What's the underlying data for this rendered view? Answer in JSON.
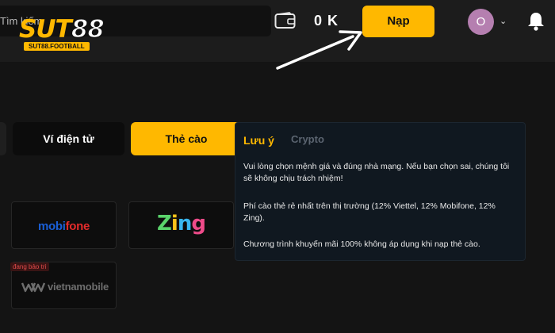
{
  "header": {
    "search_placeholder": "Tìm kiếm",
    "logo": {
      "brand": "SUT88",
      "brand_prefix": "SUT",
      "brand_suffix": "88",
      "sub": "SUT88.FOOTBALL"
    },
    "balance": "0 K",
    "deposit_label": "Nạp",
    "avatar_initial": "O",
    "icons": [
      "wallet-icon",
      "chevron-down-icon",
      "bell-icon"
    ]
  },
  "tabs": [
    {
      "label": "Ví điện tử",
      "active": false
    },
    {
      "label": "Thẻ cào",
      "active": true
    }
  ],
  "cards": [
    {
      "name": "mobifone",
      "logo_parts": [
        "mobi",
        "fone"
      ]
    },
    {
      "name": "zing",
      "logo_parts": [
        "Z",
        "i",
        "n",
        "g"
      ]
    },
    {
      "name": "vietnamobile",
      "logo": "vietnamobile",
      "badge": "đang bảo trì"
    }
  ],
  "note": {
    "tab_active": "Lưu ý",
    "tab_inactive": "Crypto",
    "paragraphs": [
      "Vui lòng chọn mệnh giá và đúng nhà mạng. Nếu bạn chọn sai, chúng tôi sẽ không chịu trách nhiệm!",
      "Phí cào thẻ rẻ nhất trên thị trường (12% Viettel, 12% Mobifone, 12% Zing).",
      "Chương trình khuyến mãi 100% không áp dụng khi nạp thẻ cào."
    ]
  },
  "colors": {
    "accent": "#ffb800",
    "background": "#141414",
    "header": "#1c1c1c",
    "panel": "#101820"
  }
}
